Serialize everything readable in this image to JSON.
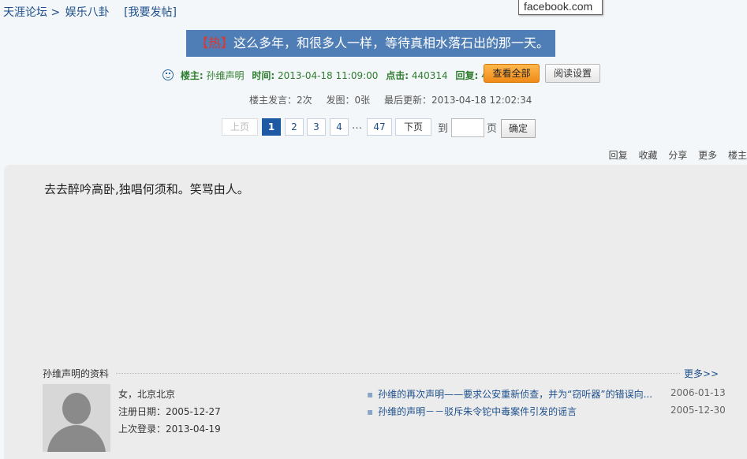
{
  "breadcrumb": {
    "site": "天涯论坛",
    "sep": ">",
    "board": "娱乐八卦",
    "post_link": "[我要发帖]"
  },
  "tooltip": {
    "text": "facebook.com"
  },
  "title": {
    "hot_tag": "【热】",
    "text": "这么多年，和很多人一样，等待真相水落石出的那一天。"
  },
  "meta": {
    "author_label": "楼主:",
    "author": "孙维声明",
    "time_label": "时间:",
    "time": "2013-04-18 11:09:00",
    "clicks_label": "点击:",
    "clicks": "440314",
    "replies_label": "回复:",
    "replies": "4707",
    "view_all_button": "查看全部",
    "read_settings_button": "阅读设置"
  },
  "stats": {
    "author_posts": "楼主发言：2次",
    "images": "发图：0张",
    "last_update": "最后更新：2013-04-18 12:02:34"
  },
  "pager": {
    "prev": "上页",
    "pages": [
      "1",
      "2",
      "3",
      "4"
    ],
    "ellipsis": "…",
    "last": "47",
    "next": "下页",
    "goto_label": "到",
    "page_unit": "页",
    "confirm": "确定",
    "current": 1
  },
  "actions": [
    "回复",
    "收藏",
    "分享",
    "更多",
    "楼主"
  ],
  "post": {
    "content": "去去醉吟高卧,独唱何须和。笑骂由人。"
  },
  "profile": {
    "title": "孙维声明的资料",
    "more": "更多>>",
    "gender_location": "女，北京北京",
    "register": "注册日期：2005-12-27",
    "last_login": "上次登录：2013-04-19"
  },
  "related": [
    {
      "title": "孙维的再次声明——要求公安重新侦查，并为“窃听器”的错误向...",
      "date": "2006-01-13"
    },
    {
      "title": "孙维的声明－－驳斥朱令铊中毒案件引发的谣言",
      "date": "2005-12-30"
    }
  ],
  "colors": {
    "title_bg": "#4f7db5",
    "hot_red": "#e0362b",
    "meta_green": "#2e7d2e",
    "link_blue": "#1d4f8c",
    "orange_button": "#f08a17",
    "active_page": "#1d5aa3"
  }
}
